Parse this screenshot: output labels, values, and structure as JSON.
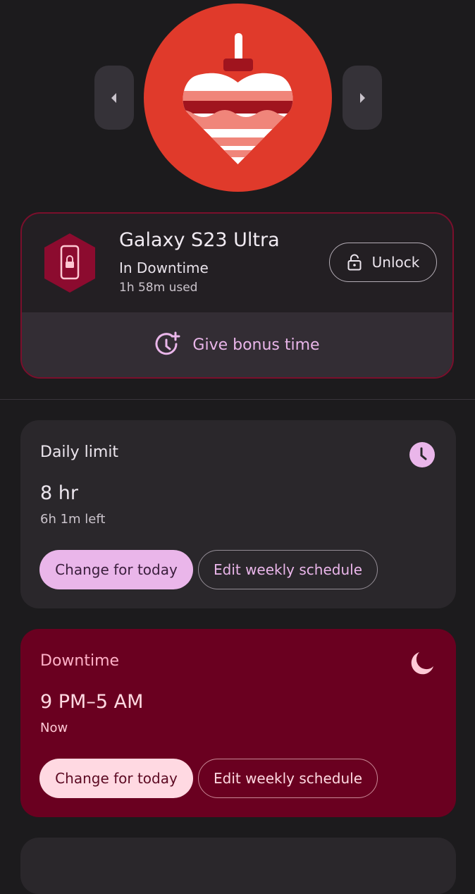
{
  "device": {
    "name": "Galaxy S23 Ultra",
    "status": "In Downtime",
    "used": "1h 58m used",
    "unlock_label": "Unlock",
    "bonus_label": "Give bonus time"
  },
  "daily_limit": {
    "title": "Daily limit",
    "value": "8 hr",
    "sub": "6h 1m left",
    "change_label": "Change for today",
    "edit_label": "Edit weekly schedule",
    "icon": "clock-icon"
  },
  "downtime": {
    "title": "Downtime",
    "value": "9 PM–5 AM",
    "sub": "Now",
    "change_label": "Change for today",
    "edit_label": "Edit weekly schedule",
    "icon": "moon-icon"
  },
  "colors": {
    "background": "#1c1b1d",
    "accent": "#eab6ea",
    "downtime_card": "#6a0020",
    "avatar_bg": "#e03a2b"
  }
}
